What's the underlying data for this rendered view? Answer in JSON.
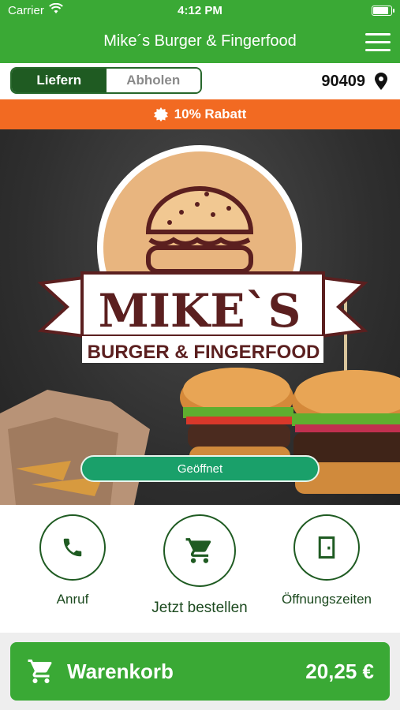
{
  "status_bar": {
    "carrier": "Carrier",
    "time": "4:12 PM"
  },
  "header": {
    "title": "Mike´s Burger & Fingerfood"
  },
  "order_mode": {
    "delivery_label": "Liefern",
    "pickup_label": "Abholen",
    "selected": "delivery",
    "zip_code": "90409"
  },
  "promo": {
    "text": "10% Rabatt"
  },
  "hero": {
    "logo_name": "MIKE`S",
    "logo_subtitle": "BURGER & FINGERFOOD",
    "status_button": "Geöffnet"
  },
  "actions": [
    {
      "label": "Anruf",
      "icon": "phone-icon"
    },
    {
      "label": "Jetzt bestellen",
      "icon": "cart-icon"
    },
    {
      "label": "Öffnungszeiten",
      "icon": "door-icon"
    }
  ],
  "cart": {
    "label": "Warenkorb",
    "total": "20,25 €"
  },
  "colors": {
    "primary_green": "#3aa935",
    "dark_green": "#1f5b22",
    "promo_orange": "#f26a22",
    "open_green": "#1aa06a",
    "logo_brown": "#5b1f1f",
    "logo_tan": "#e8b57f"
  }
}
